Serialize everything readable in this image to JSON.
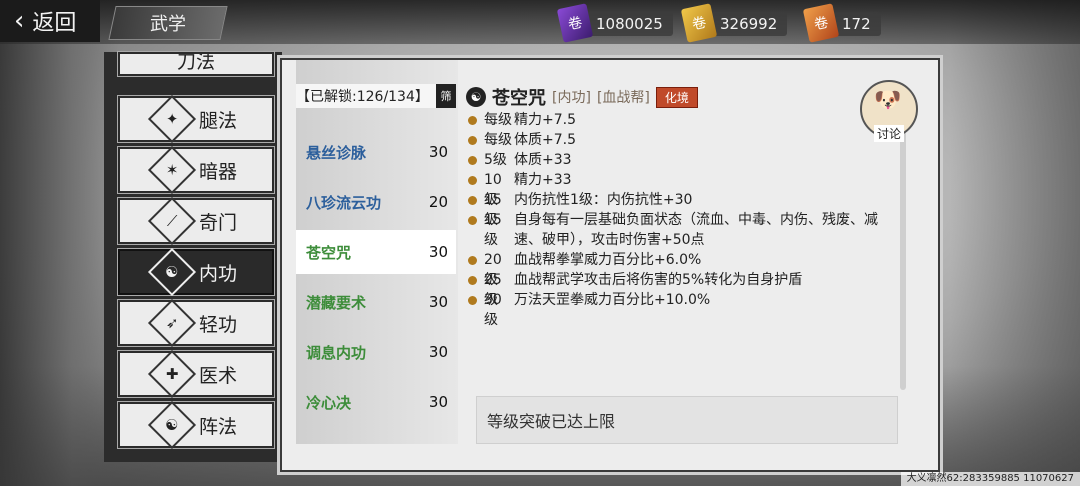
{
  "topbar": {
    "back_label": "返回",
    "title": "武学",
    "currencies": [
      {
        "icon": "purple-ticket-icon",
        "value": "1080025",
        "color": "#7a3ccc"
      },
      {
        "icon": "gold-ticket-icon",
        "value": "326992",
        "color": "#e0b13a"
      },
      {
        "icon": "orange-ticket-icon",
        "value": "172",
        "color": "#e07a2a"
      }
    ]
  },
  "categories": [
    {
      "label": "刀法",
      "icon": "blade-icon"
    },
    {
      "label": "腿法",
      "icon": "kick-icon"
    },
    {
      "label": "暗器",
      "icon": "shuriken-icon"
    },
    {
      "label": "奇门",
      "icon": "odd-weapon-icon"
    },
    {
      "label": "内功",
      "icon": "inner-power-icon",
      "active": true
    },
    {
      "label": "轻功",
      "icon": "qinggong-icon"
    },
    {
      "label": "医术",
      "icon": "medicine-icon"
    },
    {
      "label": "阵法",
      "icon": "formation-icon"
    }
  ],
  "list": {
    "unlock_label": "【已解锁:126/134】",
    "filter_label": "筛",
    "items": [
      {
        "name": "悬丝诊脉",
        "level": "30",
        "color": "blue"
      },
      {
        "name": "八珍流云功",
        "level": "20",
        "color": "blue"
      },
      {
        "name": "苍空咒",
        "level": "30",
        "color": "green",
        "selected": true
      },
      {
        "name": "潜藏要术",
        "level": "30",
        "color": "green"
      },
      {
        "name": "调息内功",
        "level": "30",
        "color": "green"
      },
      {
        "name": "冷心决",
        "level": "30",
        "color": "green"
      }
    ]
  },
  "detail": {
    "name": "苍空咒",
    "tag1": "[内功]",
    "tag2": "[血战帮]",
    "badge": "化境",
    "discuss_label": "讨论",
    "effects": [
      {
        "level": "每级",
        "text": "精力+7.5"
      },
      {
        "level": "每级",
        "text": "体质+7.5"
      },
      {
        "level": "5级",
        "text": "体质+33"
      },
      {
        "level": "10级",
        "text": "精力+33"
      },
      {
        "level": "15级",
        "text": "内伤抗性1级：内伤抗性+30"
      },
      {
        "level": "15级",
        "text": "自身每有一层基础负面状态（流血、中毒、内伤、残废、减速、破甲），攻击时伤害+50点"
      },
      {
        "level": "20级",
        "text": "血战帮拳掌威力百分比+6.0%"
      },
      {
        "level": "25级",
        "text": "血战帮武学攻击后将伤害的5%转化为自身护盾"
      },
      {
        "level": "30级",
        "text": "万法天罡拳威力百分比+10.0%"
      }
    ],
    "cap_text": "等级突破已达上限"
  },
  "footer": "大义凛然62:283359885 11070627"
}
